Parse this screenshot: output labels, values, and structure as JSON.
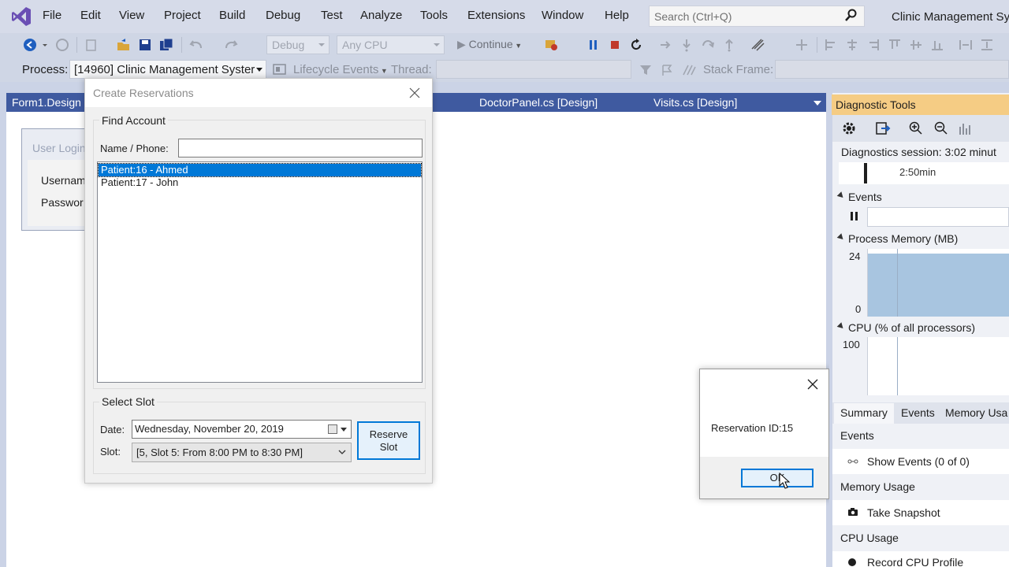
{
  "menu": {
    "items": [
      "File",
      "Edit",
      "View",
      "Project",
      "Build",
      "Debug",
      "Test",
      "Analyze",
      "Tools",
      "Extensions",
      "Window",
      "Help"
    ],
    "search_placeholder": "Search (Ctrl+Q)",
    "app_title": "Clinic Management Sy"
  },
  "toolbar": {
    "config": "Debug",
    "platform": "Any CPU",
    "continue_label": "Continue"
  },
  "locbar": {
    "process_label": "Process:",
    "process_value": "[14960] Clinic Management Syster",
    "lifecycle_label": "Lifecycle Events",
    "thread_label": "Thread:",
    "stackframe_label": "Stack Frame:"
  },
  "tabs": {
    "form1": "Form1.Design",
    "doctorpanel": "DoctorPanel.cs [Design]",
    "visits": "Visits.cs [Design]"
  },
  "login": {
    "title": "User Login",
    "username": "Usernam",
    "password": "Passwor"
  },
  "dialog": {
    "title": "Create Reservations",
    "find_account": "Find Account",
    "name_label": "Name / Phone:",
    "name_value": "",
    "patients": [
      "Patient:16 - Ahmed",
      "Patient:17 - John"
    ],
    "select_slot": "Select Slot",
    "date_label": "Date:",
    "date_value": "Wednesday, November 20, 2019",
    "slot_label": "Slot:",
    "slot_value": "[5, Slot 5: From 8:00 PM to 8:30 PM]",
    "reserve_line1": "Reserve",
    "reserve_line2": "Slot"
  },
  "msgbox": {
    "text": "Reservation ID:15",
    "ok": "OK"
  },
  "diag": {
    "title": "Diagnostic Tools",
    "session": "Diagnostics session: 3:02 minut",
    "timeline_label": "2:50min",
    "events": "Events",
    "process_memory": "Process Memory (MB)",
    "mem_max": "24",
    "mem_min": "0",
    "cpu": "CPU (% of all processors)",
    "cpu_max": "100",
    "tabs": [
      "Summary",
      "Events",
      "Memory Usa"
    ],
    "events_heading": "Events",
    "show_events": "Show Events (0 of 0)",
    "memory_heading": "Memory Usage",
    "take_snapshot": "Take Snapshot",
    "cpu_heading": "CPU Usage",
    "record_cpu": "Record CPU Profile"
  },
  "colors": {
    "accent": "#0078d7",
    "tab_strip": "#3f5aa0",
    "diag_header": "#f5cc84"
  }
}
